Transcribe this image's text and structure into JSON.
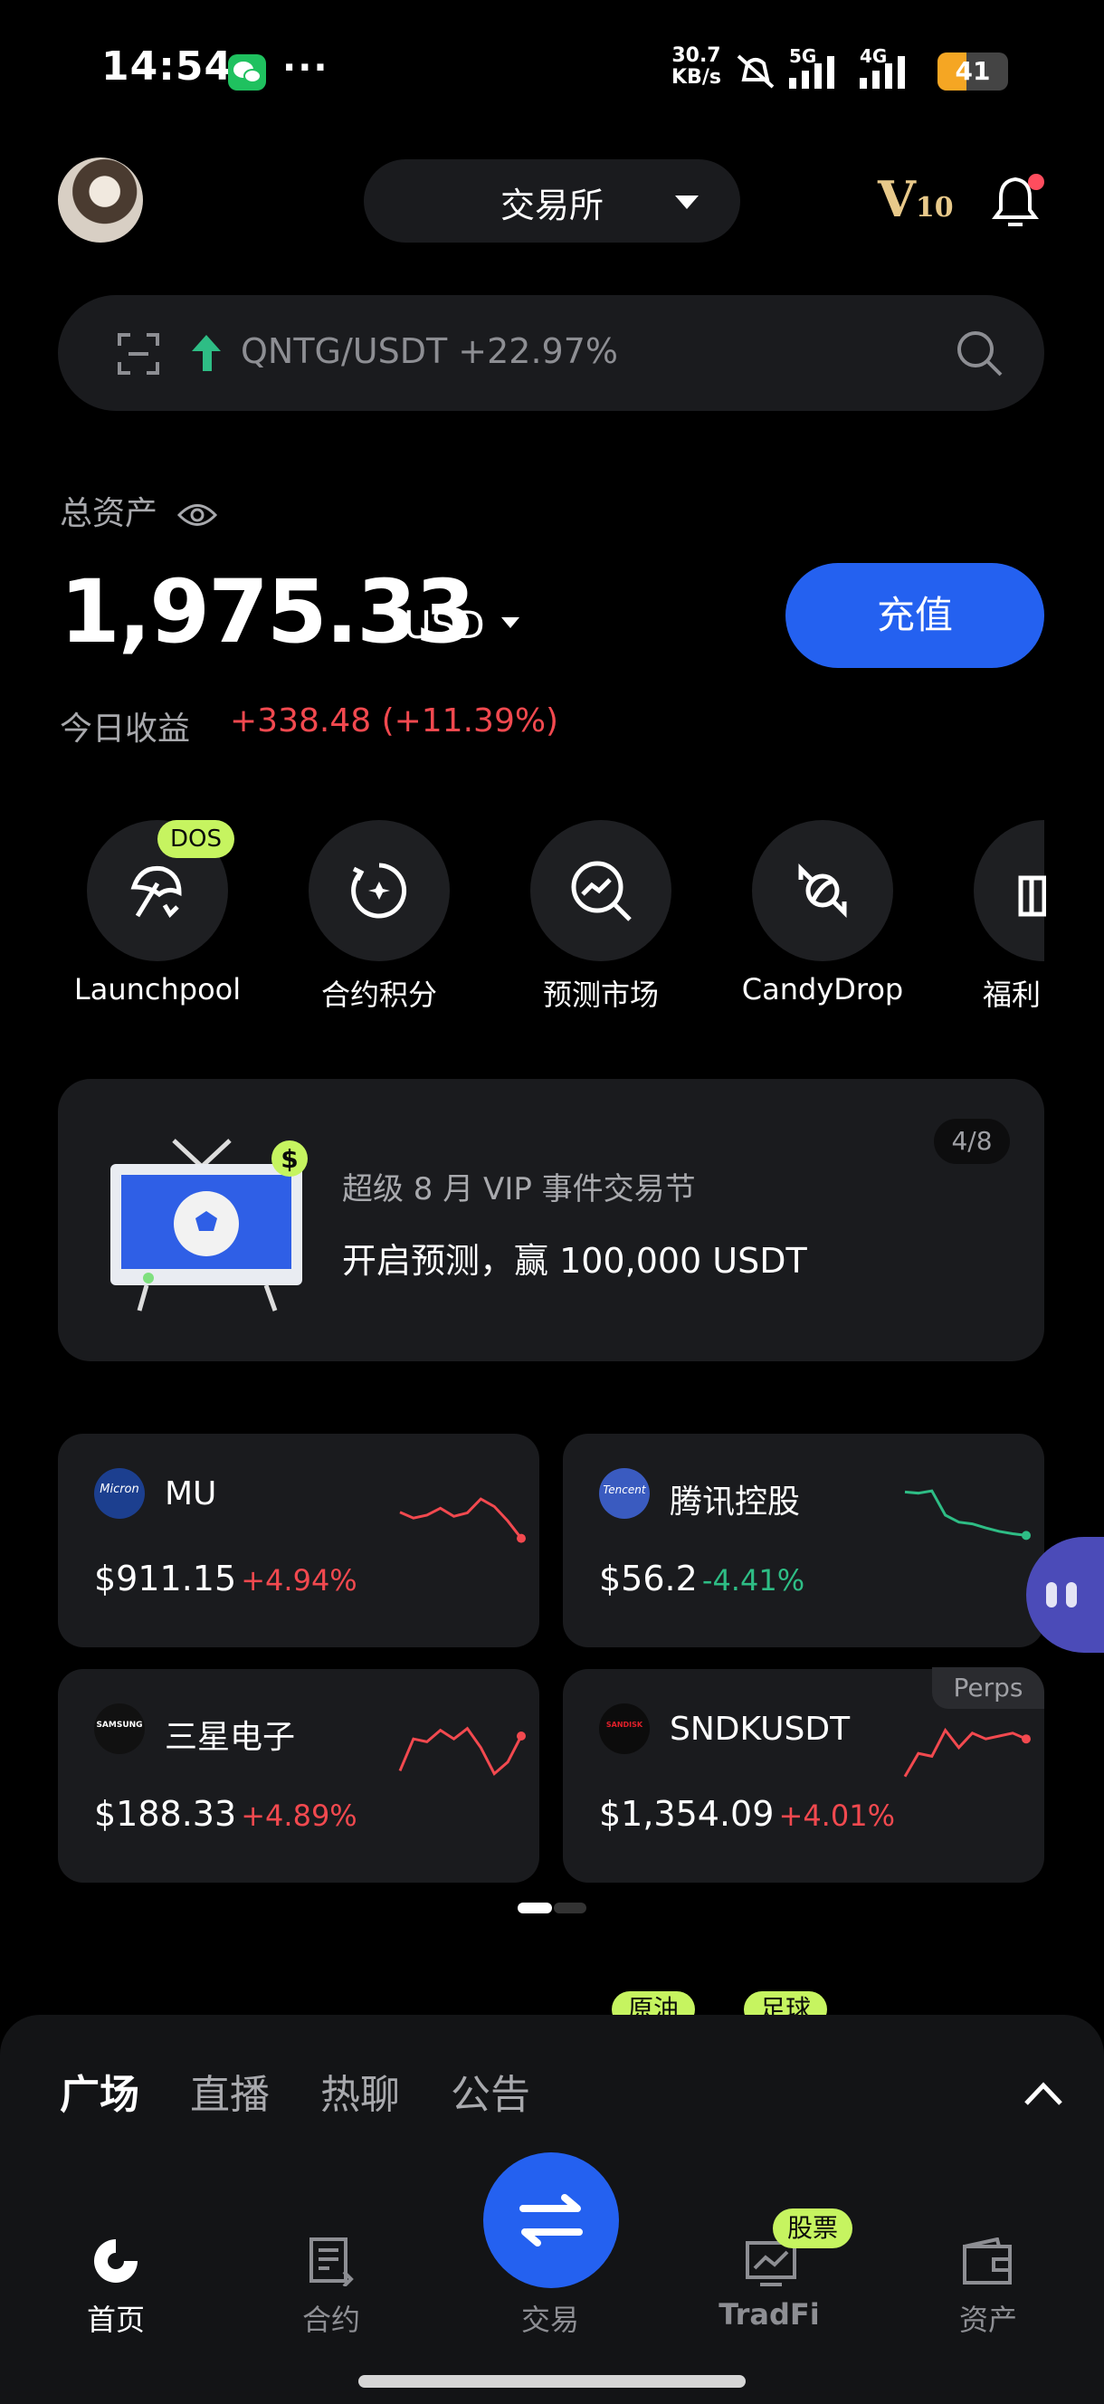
{
  "status_bar": {
    "time": "14:54",
    "net_speed_value": "30.7",
    "net_speed_unit": "KB/s",
    "net_5g": "5G",
    "net_4g": "4G",
    "battery": "41",
    "battery_level": 0.41
  },
  "header": {
    "exchange_label": "交易所",
    "vip_letter": "V",
    "vip_level": "10"
  },
  "search": {
    "text": "QNTG/USDT +22.97%"
  },
  "assets": {
    "total_label": "总资产",
    "balance": "1,975.33",
    "currency": "USD",
    "deposit_label": "充值",
    "today_label": "今日收益",
    "today_value": "+338.48 (+11.39%)"
  },
  "quick_menu": [
    {
      "label": "Launchpool",
      "badge": "DOS",
      "icon": "umbrella-icon"
    },
    {
      "label": "合约积分",
      "icon": "refresh-star-icon"
    },
    {
      "label": "预测市场",
      "icon": "chart-search-icon"
    },
    {
      "label": "CandyDrop",
      "icon": "candy-icon"
    },
    {
      "label": "福利",
      "icon": "gift-icon"
    }
  ],
  "promo": {
    "page": "4/8",
    "subtitle": "超级 8 月 VIP 事件交易节",
    "title": "开启预测，赢 100,000 USDT"
  },
  "tickers": [
    {
      "logo": "Micron",
      "name": "MU",
      "price": "$911.15",
      "change": "+4.94%",
      "trend": "up",
      "spark": [
        0.45,
        0.55,
        0.5,
        0.38,
        0.52,
        0.46,
        0.22,
        0.35,
        0.6,
        0.9
      ]
    },
    {
      "logo": "Tencent",
      "name": "腾讯控股",
      "price": "$56.2",
      "change": "-4.41%",
      "trend": "down",
      "spark": [
        0.1,
        0.12,
        0.08,
        0.5,
        0.62,
        0.65,
        0.72,
        0.78,
        0.82,
        0.85
      ]
    },
    {
      "logo": "SAMSUNG",
      "name": "三星电子",
      "price": "$188.33",
      "change": "+4.89%",
      "trend": "up",
      "spark": [
        0.85,
        0.3,
        0.35,
        0.15,
        0.3,
        0.12,
        0.45,
        0.9,
        0.7,
        0.25
      ]
    },
    {
      "logo": "SANDISK",
      "name": "SNDKUSDT",
      "price": "$1,354.09",
      "change": "+4.01%",
      "trend": "up",
      "badge": "Perps",
      "spark": [
        0.95,
        0.55,
        0.6,
        0.15,
        0.45,
        0.2,
        0.3,
        0.25,
        0.2,
        0.3
      ]
    }
  ],
  "tags": [
    "原油",
    "足球"
  ],
  "bottom_panel": {
    "tabs": [
      "广场",
      "直播",
      "热聊",
      "公告"
    ]
  },
  "nav": {
    "home": "首页",
    "futures": "合约",
    "trade": "交易",
    "tradfi": "TradFi",
    "tradfi_badge": "股票",
    "assets": "资产"
  },
  "colors": {
    "accent": "#2461f0",
    "up": "#f2494f",
    "down": "#2ebd85",
    "badge": "#c6f460"
  }
}
